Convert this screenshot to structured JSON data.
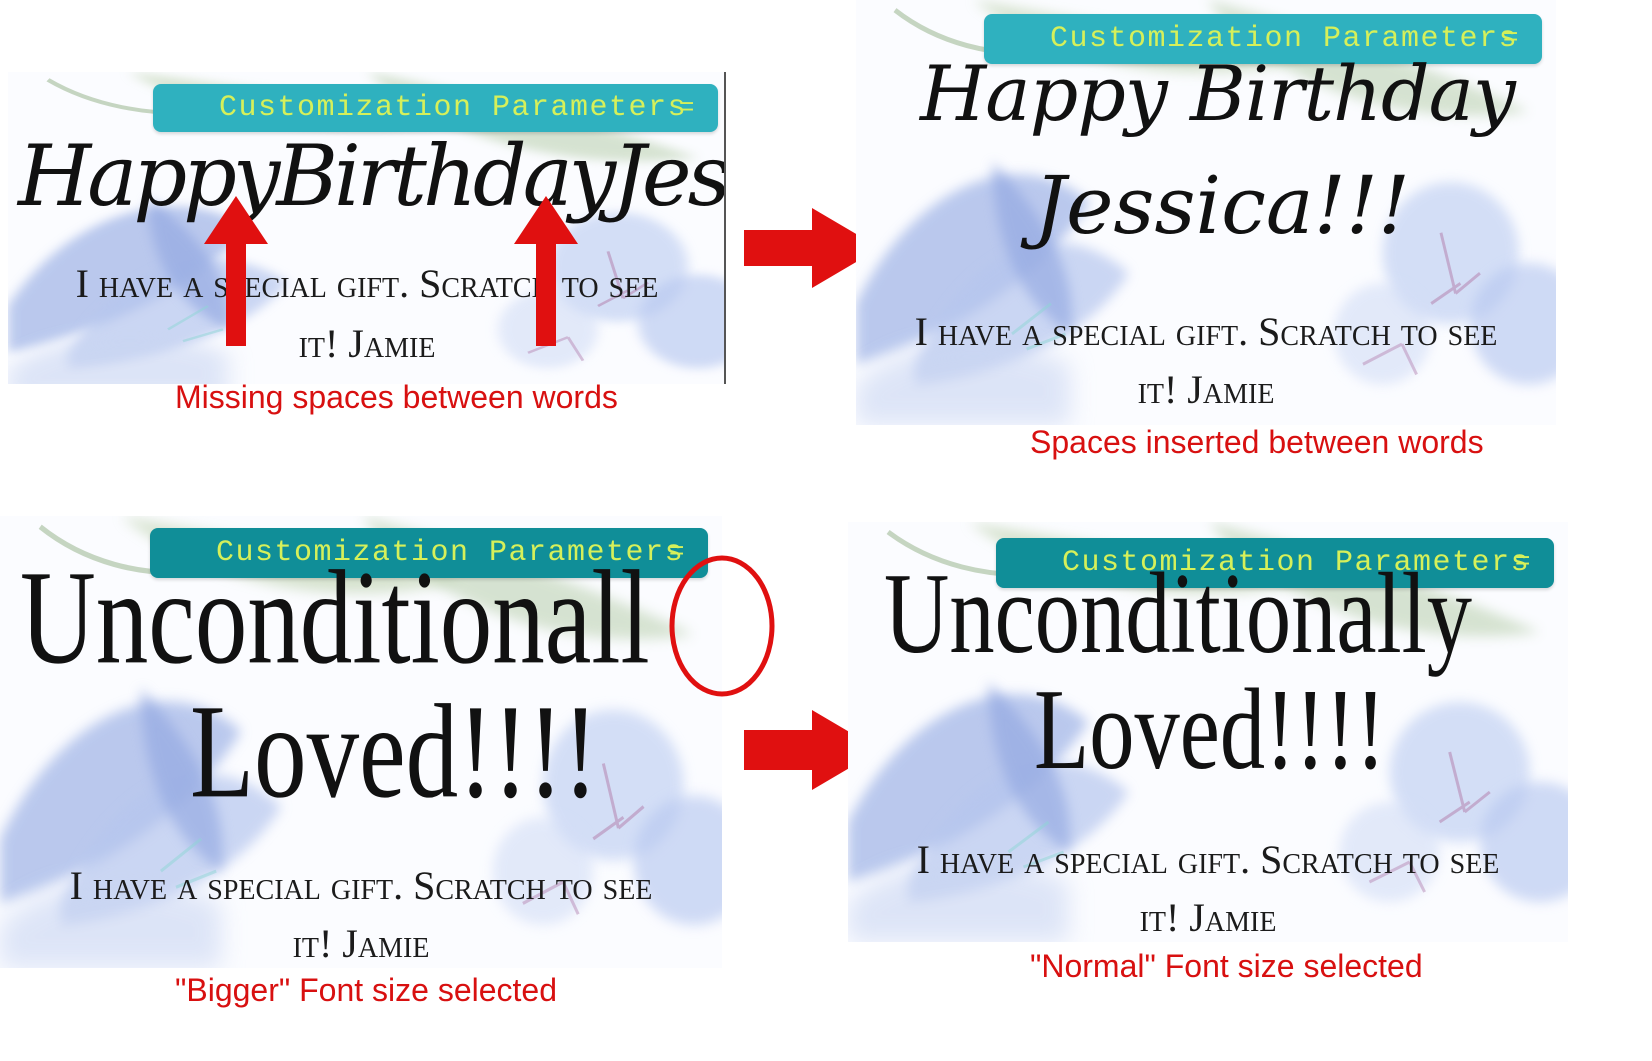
{
  "toolbar_label": "Customization Parameters",
  "toolbar_menu_glyph": "=",
  "panels": {
    "top_left": {
      "greeting": "HappyBirthdayJessi",
      "message_line1": "I have a special gift. Scratch to see",
      "message_line2": "it! Jamie",
      "caption": "Missing spaces between words"
    },
    "top_right": {
      "greeting_line1": "Happy Birthday",
      "greeting_line2": "Jessica!!!",
      "message_line1": "I have a special gift. Scratch to see",
      "message_line2": "it! Jamie",
      "caption": "Spaces inserted between words"
    },
    "bottom_left": {
      "greeting_line1": "Unconditionall",
      "greeting_line2": "Loved!!!!",
      "message_line1": "I have a special gift. Scratch to see",
      "message_line2": "it! Jamie",
      "caption": "\"Bigger\" Font size selected"
    },
    "bottom_right": {
      "greeting_line1": "Unconditionally",
      "greeting_line2": "Loved!!!!",
      "message_line1": "I have a special gift. Scratch to see",
      "message_line2": "it! Jamie",
      "caption": "\"Normal\" Font size selected"
    }
  },
  "colors": {
    "annotation_red": "#e01010",
    "toolbar_teal_light": "#2fb1bf",
    "toolbar_teal_dark": "#0f8d96",
    "toolbar_text": "#d6f05a",
    "flower_blue": "#9fb3e6"
  }
}
